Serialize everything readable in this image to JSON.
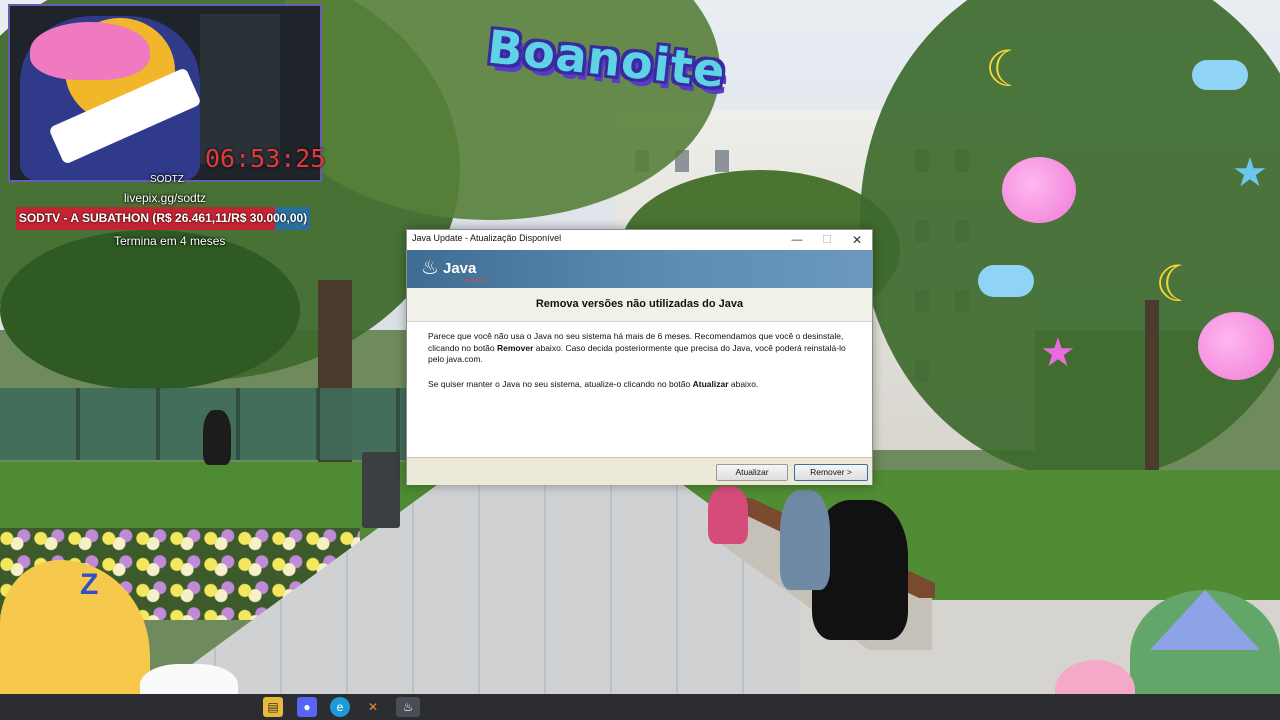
{
  "stream": {
    "timer": "06:53:25",
    "username": "SODTZ",
    "donation_url": "livepix.gg/sodtz",
    "goal_label": "SODTV - A SUBATHON (R$ 26.461,11/R$ 30.000,00)",
    "goal_progress": 0.882,
    "ends_in": "Termina em 4 meses",
    "banner_text": "Boanoite"
  },
  "dialog": {
    "title": "Java Update - Atualização Disponível",
    "minimize_icon": "minimize-icon",
    "maximize_icon": "maximize-icon",
    "close_icon": "close-icon",
    "brand": {
      "word": "Java",
      "sub": "ORACLE"
    },
    "headline": "Remova versões não utilizadas do Java",
    "para1_a": "Parece que você não usa o Java no seu sistema há mais de 6 meses. Recomendamos que você o desinstale, clicando no botão ",
    "para1_bold": "Remover",
    "para1_b": " abaixo. Caso decida posteriormente que precisa do Java, você poderá reinstalá-lo pelo java.com.",
    "para2_a": "Se quiser manter o Java no seu sistema, atualize-o clicando no botão ",
    "para2_bold": "Atualizar",
    "para2_b": " abaixo.",
    "update_label": "Atualizar",
    "remove_label": "Remover >"
  },
  "taskbar": {
    "icons": [
      "file-explorer-icon",
      "discord-icon",
      "edge-icon",
      "app-icon",
      "java-update-icon"
    ]
  },
  "colors": {
    "banner": "#4f7ea4",
    "goal_fill": "#c22531",
    "goal_bg": "#2a6f9b",
    "timer": "#e23a3a"
  }
}
